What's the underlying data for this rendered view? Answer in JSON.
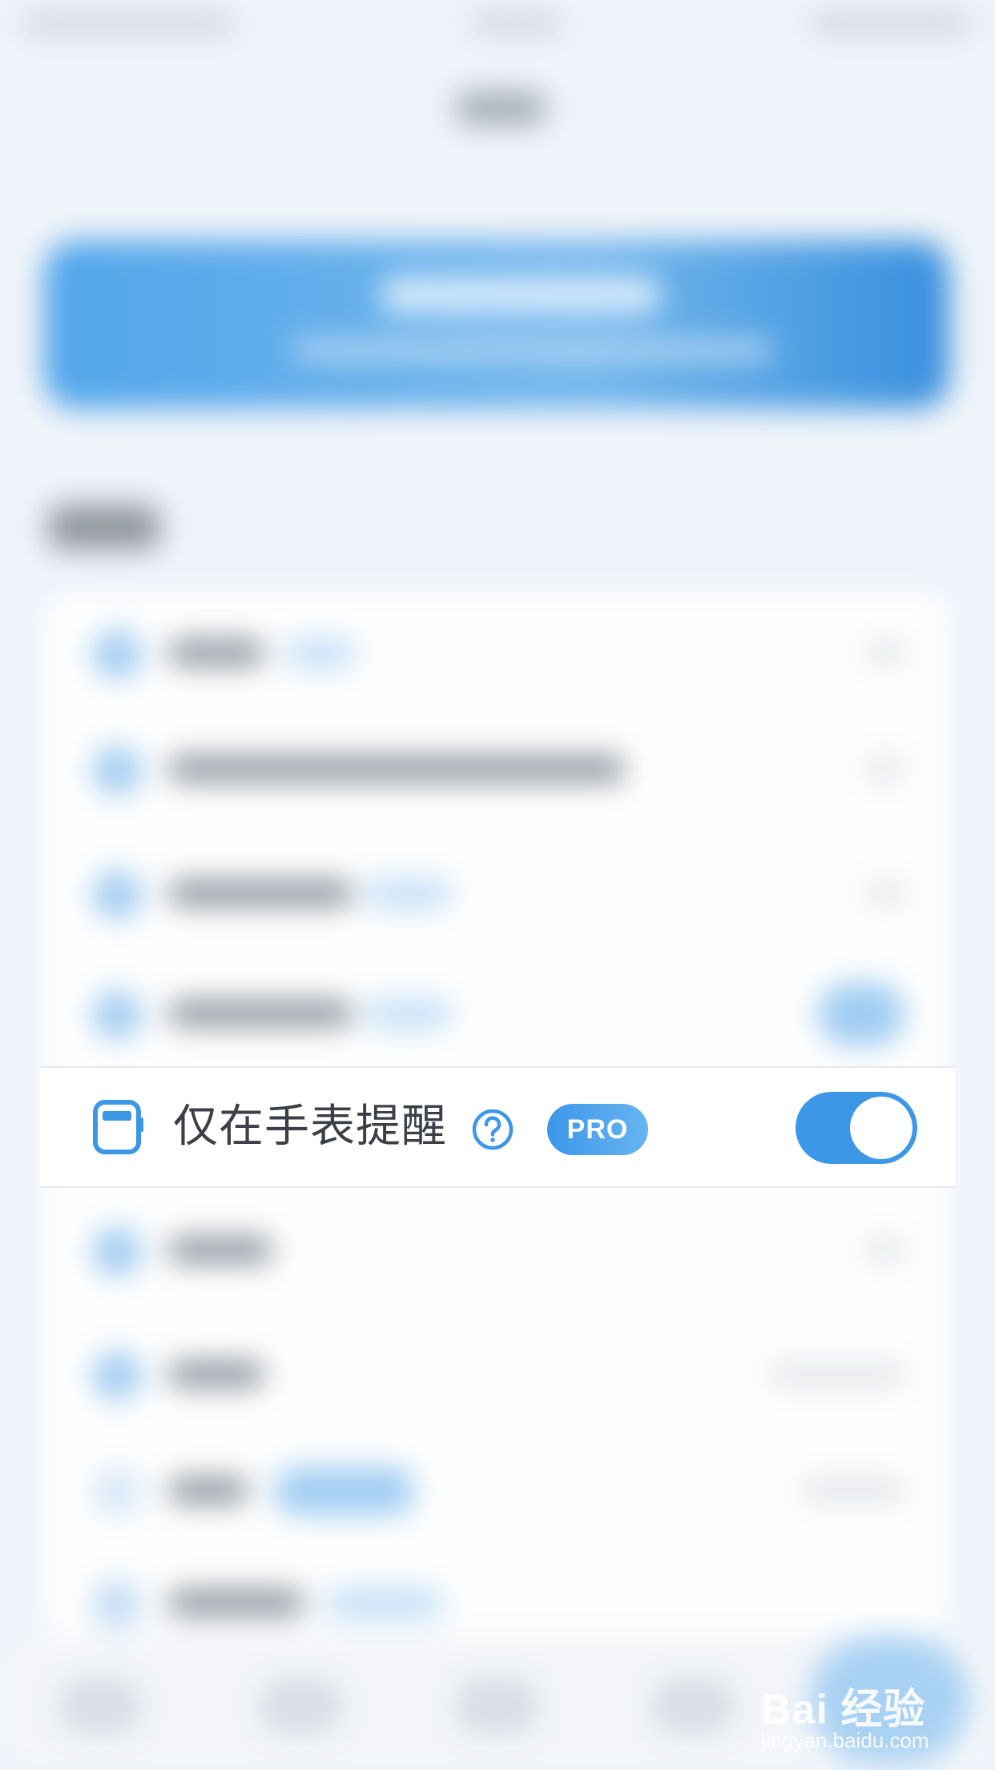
{
  "focused_row": {
    "icon": "watch-icon",
    "label": "仅在手表提醒",
    "help_icon": "question-circle-icon",
    "badge": "PRO",
    "toggle_on": true
  },
  "colors": {
    "accent": "#3d97e7",
    "label_text": "#3b4048",
    "background": "#eef3f9"
  },
  "watermark": {
    "brand": "Bai 经验",
    "url": "jingyan.baidu.com"
  }
}
